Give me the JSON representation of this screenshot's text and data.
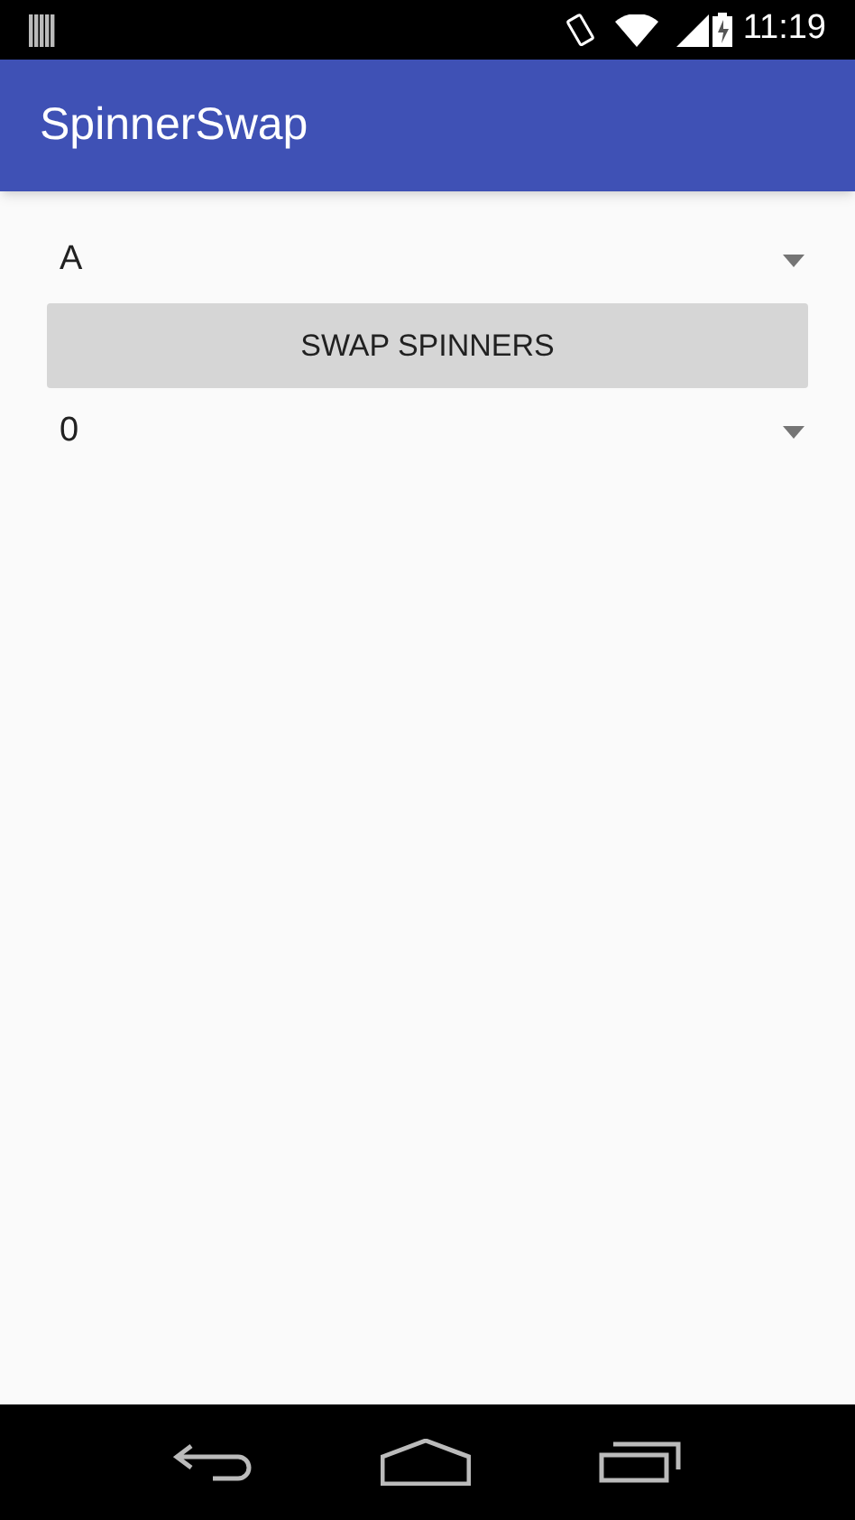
{
  "status_bar": {
    "time": "11:19"
  },
  "app_bar": {
    "title": "SpinnerSwap"
  },
  "spinners": [
    {
      "value": "A"
    },
    {
      "value": "0"
    }
  ],
  "swap_button": {
    "label": "SWAP SPINNERS"
  }
}
